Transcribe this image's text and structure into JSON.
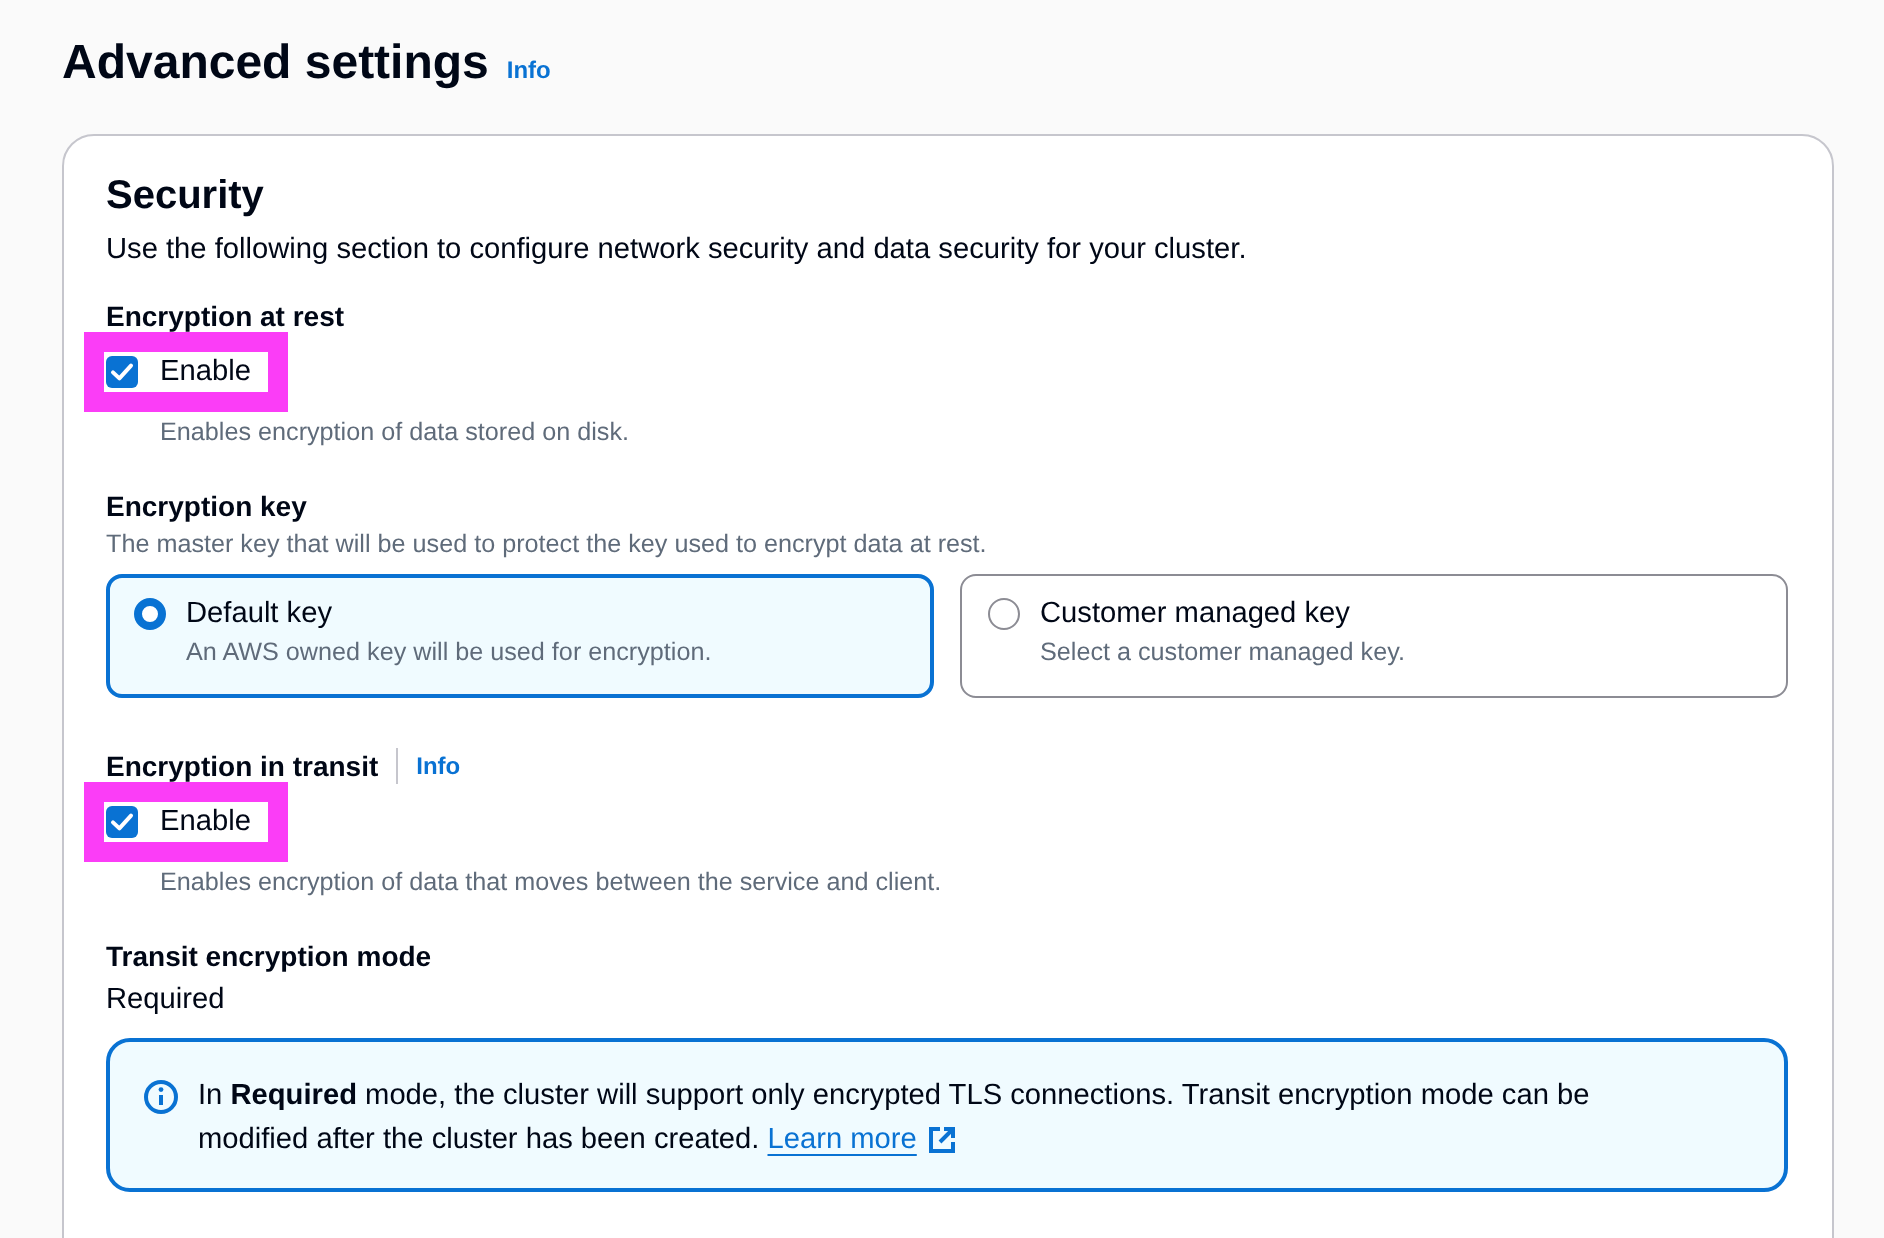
{
  "page": {
    "title": "Advanced settings",
    "info_link": "Info"
  },
  "section": {
    "title": "Security",
    "description": "Use the following section to configure network security and data security for your cluster."
  },
  "fields": [
    {
      "kind": "checkbox",
      "label": "Encryption at rest",
      "checkbox": {
        "label": "Enable",
        "checked": true,
        "highlighted": true
      },
      "description": "Enables encryption of data stored on disk."
    },
    {
      "kind": "tiles",
      "label": "Encryption key",
      "description": "The master key that will be used to protect the key used to encrypt data at rest.",
      "options": [
        {
          "label": "Default key",
          "description": "An AWS owned key will be used for encryption.",
          "selected": true
        },
        {
          "label": "Customer managed key",
          "description": "Select a customer managed key.",
          "selected": false
        }
      ]
    },
    {
      "kind": "checkbox",
      "label": "Encryption in transit",
      "info_link": "Info",
      "checkbox": {
        "label": "Enable",
        "checked": true,
        "highlighted": true
      },
      "description": "Enables encryption of data that moves between the service and client."
    },
    {
      "kind": "value",
      "label": "Transit encryption mode",
      "value": "Required"
    },
    {
      "kind": "alert",
      "text": "In **Required** mode, the cluster will support only encrypted TLS connections. Transit encryption mode can be modified after the cluster has been created.",
      "link": "Learn more"
    }
  ]
}
